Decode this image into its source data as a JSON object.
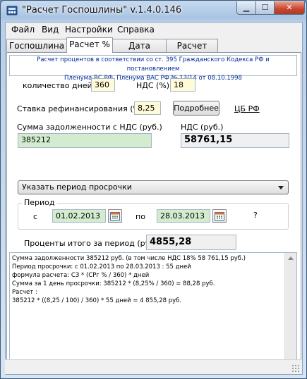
{
  "window": {
    "title": "\"Расчет Госпошлины\" v.1.4.0.146",
    "min_glyph": "▁",
    "max_glyph": "☐",
    "close_glyph": "✕"
  },
  "menu": [
    "Файл",
    "Вид",
    "Настройки",
    "Справка"
  ],
  "tabs": [
    "Госпошлина",
    "Расчет %",
    "Дата сервис",
    "Расчет НДС"
  ],
  "active_tab": 1,
  "notice": {
    "line1": "Расчет процентов в соответствии со ст. 395 Гражданского Кодекса РФ и постановлением",
    "line2": "Пленума ВС РФ, Пленума ВАС РФ № 13/14 от 08.10.1998"
  },
  "form": {
    "days_label": "количество дней",
    "days_value": "360",
    "nds_label": "НДС (%)",
    "nds_value": "18",
    "rate_label": "Ставка рефинансирования (%)",
    "rate_value": "8,25",
    "details_button": "Подробнее",
    "cb_link": "ЦБ РФ",
    "debt_label": "Сумма задолженности с НДС (руб.)",
    "debt_value": "385212",
    "nds_rub_label": "НДС (руб.)",
    "nds_rub_value": "58761,15",
    "period_combo": "Указать период просрочки",
    "period_group": "Период",
    "from_label": "с",
    "from_date": "01.02.2013",
    "to_label": "по",
    "to_date": "28.03.2013",
    "help": "?",
    "total_label": "Проценты итого за период (руб.)",
    "total_value": "4855,28"
  },
  "memo_lines": [
    "Сумма задолженности 385212 руб. (в том числе НДС 18%  58 761,15 руб.)",
    "Период просрочки: с 01.02.2013 по 28.03.2013 : 55 дней",
    "формула расчета: СЗ * (СРг % / 360) * дней",
    "Сумма за 1 день просрочки: 385212 * (8,25%  / 360)  = 88,28 руб.",
    "Расчет :",
    "385212 * ((8,25 / 100) / 360) * 55 дней  = 4 855,28 руб."
  ],
  "colors": {
    "input_yellow": "#fffbd8",
    "input_green": "#d3ecd0",
    "notice_text": "#002a9a",
    "close_red": "#c8452e"
  }
}
